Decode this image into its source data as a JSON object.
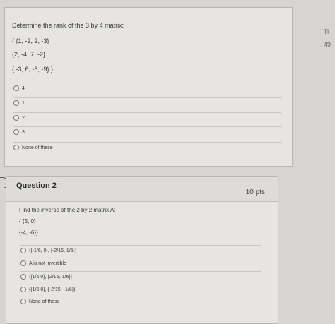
{
  "sidebar": {
    "line1": "Ti",
    "line2": "49"
  },
  "q1": {
    "prompt": "Determine the rank of the  3 by 4 matrix:",
    "rows": [
      "{ {1, -2, 2, -3}",
      "{2, -4, 7, -2}",
      "{ -3, 6, -6, -9} }"
    ],
    "options": [
      "4",
      "1",
      "2",
      "3",
      "None of these"
    ]
  },
  "q2": {
    "title": "Question 2",
    "points": "10 pts",
    "prompt": "Find the inverse of the 2 by 2 matrix A:",
    "rows": [
      "{ {5, 0}",
      "{-4, -6}}"
    ],
    "options": [
      "{{-1/6, 0}, {-2/15, 1/5}}",
      "A is not invertible",
      "{{1/5,0}, {2/15,-1/6}}",
      "{{1/5,0}, {-2/15, -1/6}}",
      "None of these"
    ]
  }
}
